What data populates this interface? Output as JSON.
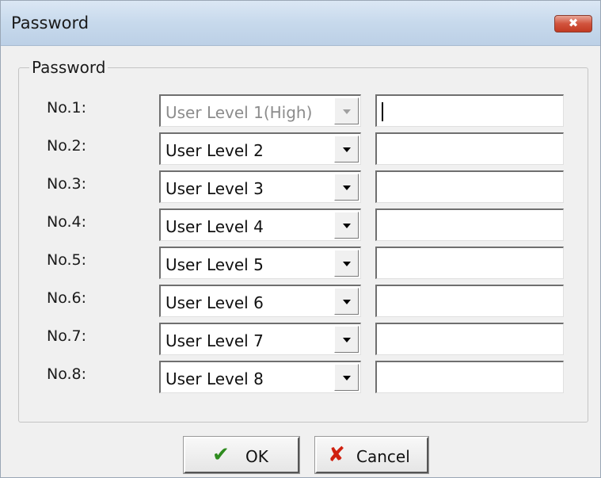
{
  "window": {
    "title": "Password",
    "close_glyph": "✖"
  },
  "group": {
    "legend": "Password"
  },
  "rows": [
    {
      "label": "No.1:",
      "level": "User Level 1(High)",
      "disabled": true,
      "password": ""
    },
    {
      "label": "No.2:",
      "level": "User Level 2",
      "disabled": false,
      "password": ""
    },
    {
      "label": "No.3:",
      "level": "User Level 3",
      "disabled": false,
      "password": ""
    },
    {
      "label": "No.4:",
      "level": "User Level 4",
      "disabled": false,
      "password": ""
    },
    {
      "label": "No.5:",
      "level": "User Level 5",
      "disabled": false,
      "password": ""
    },
    {
      "label": "No.6:",
      "level": "User Level 6",
      "disabled": false,
      "password": ""
    },
    {
      "label": "No.7:",
      "level": "User Level 7",
      "disabled": false,
      "password": ""
    },
    {
      "label": "No.8:",
      "level": "User Level 8",
      "disabled": false,
      "password": ""
    }
  ],
  "buttons": {
    "ok_label": "OK",
    "ok_icon": "check-icon",
    "cancel_label": "Cancel",
    "cancel_icon": "x-mark-icon"
  },
  "colors": {
    "titlebar": "#c7d9ec",
    "close_button": "#c23a22",
    "ok_icon": "#2e8b1e",
    "cancel_icon": "#d0200f",
    "disabled_text": "#8c8c8c"
  }
}
